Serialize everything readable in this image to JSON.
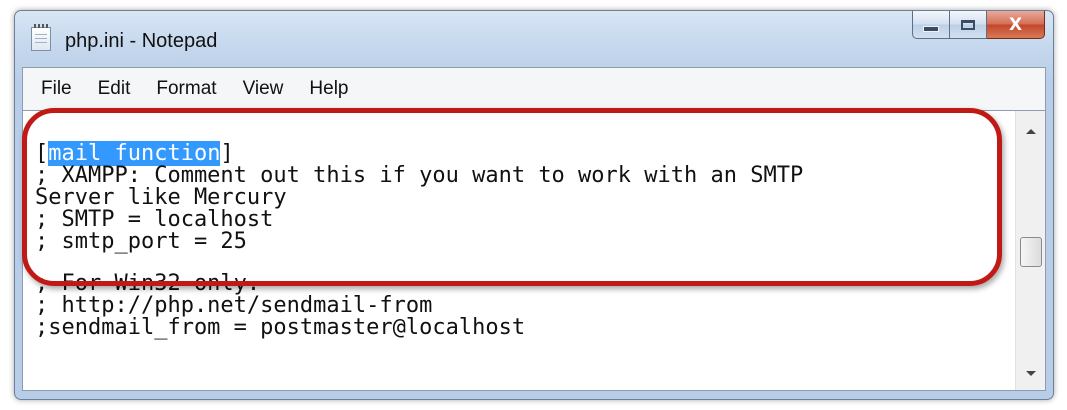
{
  "window": {
    "title": "php.ini - Notepad",
    "app_icon": "notepad-icon",
    "controls": {
      "minimize": "minimize-icon",
      "maximize": "maximize-icon",
      "close_label": "X"
    }
  },
  "menu": {
    "items": [
      {
        "label": "File"
      },
      {
        "label": "Edit"
      },
      {
        "label": "Format"
      },
      {
        "label": "View"
      },
      {
        "label": "Help"
      }
    ]
  },
  "editor": {
    "selected_text": "mail function",
    "section_open": "[",
    "section_close": "]",
    "lines": [
      "; XAMPP: Comment out this if you want to work with an SMTP",
      "Server like Mercury",
      "; SMTP = localhost",
      "; smtp_port = 25",
      "",
      "; For Win32 only.",
      "; http://php.net/sendmail-from",
      ";sendmail_from = postmaster@localhost"
    ]
  },
  "colors": {
    "selection": "#3399ff",
    "annotation": "#c01a17"
  }
}
